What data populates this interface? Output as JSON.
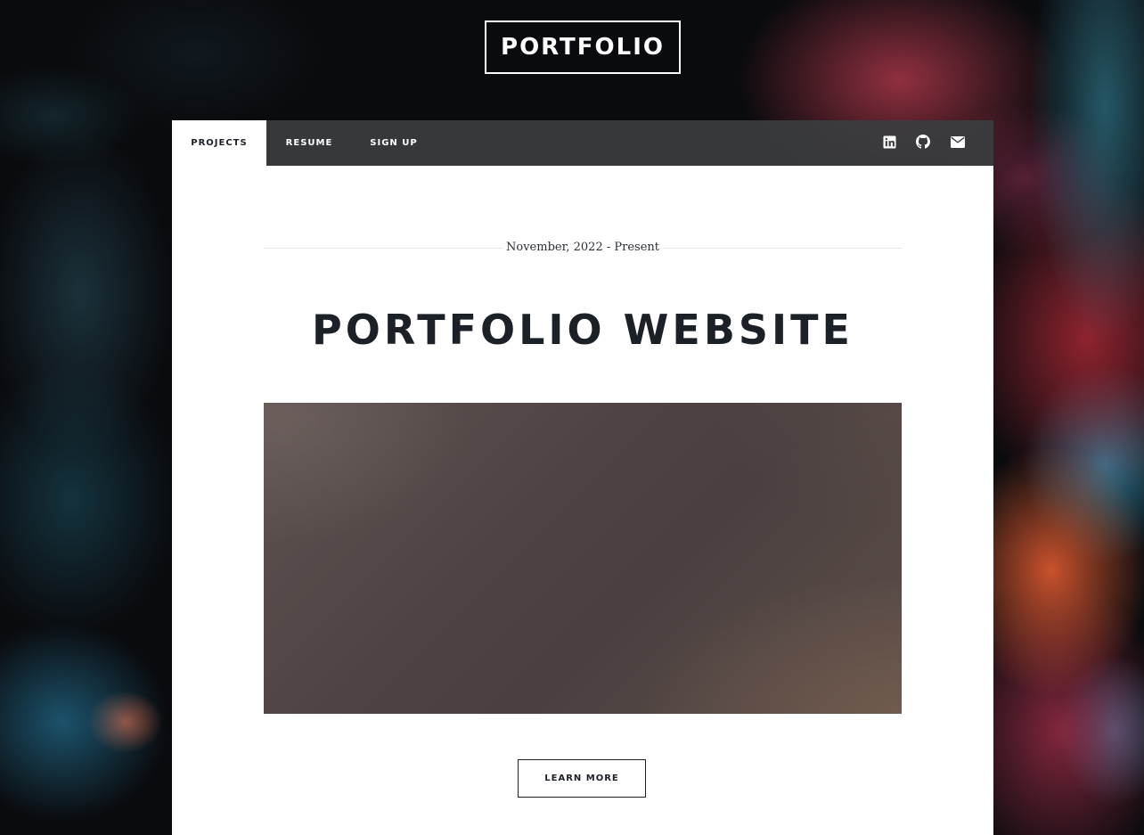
{
  "header": {
    "site_title": "PORTFOLIO"
  },
  "nav": {
    "links": [
      {
        "label": "PROJECTS",
        "active": true
      },
      {
        "label": "RESUME",
        "active": false
      },
      {
        "label": "SIGN UP",
        "active": false
      }
    ],
    "icons": [
      "linkedin-icon",
      "github-icon",
      "envelope-icon"
    ]
  },
  "post": {
    "date": "November, 2022 - Present",
    "title": "PORTFOLIO WEBSITE",
    "button_label": "LEARN MORE"
  },
  "colors": {
    "text_dark": "#1c2127",
    "nav_bg": "#3a3c40",
    "white": "#ffffff"
  }
}
